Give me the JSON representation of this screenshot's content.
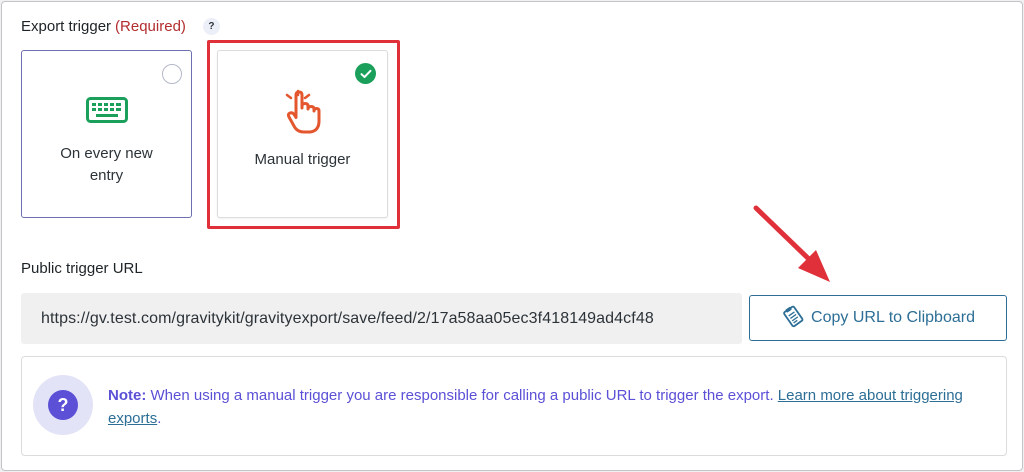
{
  "export_trigger": {
    "label": "Export trigger",
    "required": "(Required)",
    "help": "?",
    "options": [
      {
        "label": "On every new entry",
        "icon": "keyboard-icon",
        "selected": false
      },
      {
        "label": "Manual trigger",
        "icon": "pointer-hand-icon",
        "selected": true
      }
    ]
  },
  "public_url": {
    "label": "Public trigger URL",
    "value": "https://gv.test.com/gravitykit/gravityexport/save/feed/2/17a58aa05ec3f418149ad4cf48",
    "copy_button": "Copy URL to Clipboard"
  },
  "note": {
    "prefix": "Note:",
    "text": "When using a manual trigger you are responsible for calling a public URL to trigger the export.",
    "link": "Learn more about triggering exports",
    "suffix": "."
  },
  "colors": {
    "accent": "#5b50d6",
    "link": "#2c6e96",
    "required": "#b32d2e",
    "highlight": "#e0303a",
    "check": "#1aa05a",
    "keyboard_icon": "#1aa05a",
    "hand_icon": "#e4572e"
  }
}
